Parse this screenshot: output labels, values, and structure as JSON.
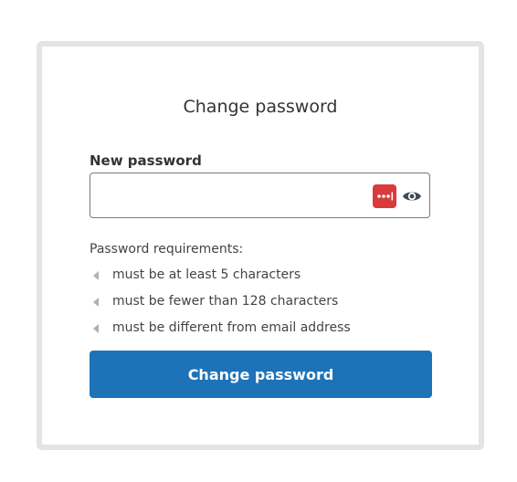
{
  "form": {
    "title": "Change password",
    "field_label": "New password",
    "input_value": "",
    "input_placeholder": "",
    "password_manager_icon": "password-manager-dots-icon",
    "toggle_visibility_icon": "eye-icon",
    "requirements_heading": "Password requirements:",
    "requirements": [
      {
        "text": "must be at least 5 characters",
        "icon": "arrow-left-icon"
      },
      {
        "text": "must be fewer than 128 characters",
        "icon": "arrow-left-icon"
      },
      {
        "text": "must be different from email address",
        "icon": "arrow-left-icon"
      }
    ],
    "submit_label": "Change password"
  },
  "colors": {
    "accent": "#1e73b8",
    "password_manager": "#d93b3b",
    "card_border": "#e4e4e4",
    "requirement_marker": "#b0b0b0"
  }
}
